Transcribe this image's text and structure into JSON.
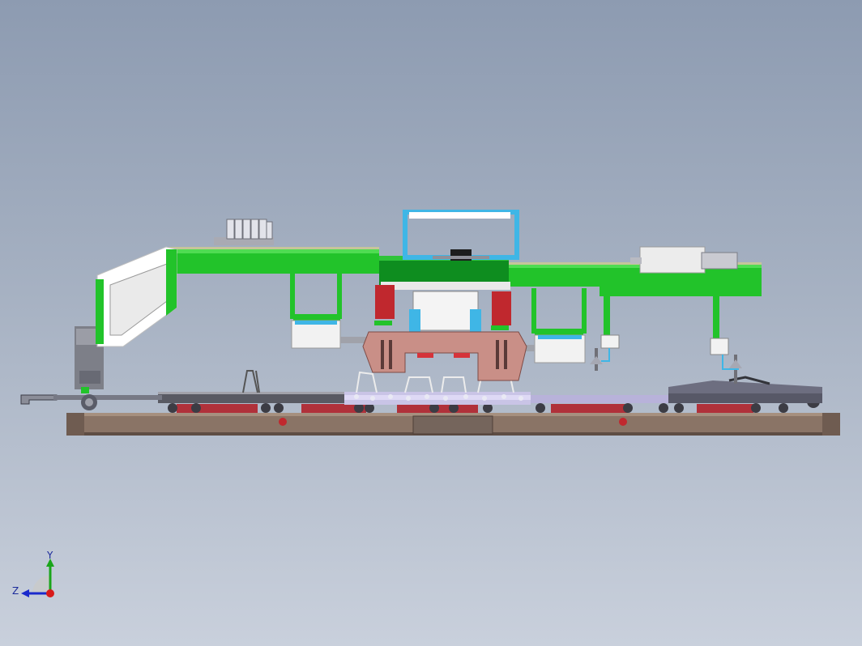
{
  "viewport": {
    "background_top": "#8d9bb1",
    "background_bottom": "#c9d0dc"
  },
  "model_colors": {
    "green": "#22c32a",
    "dark_green": "#0e7a1a",
    "base": "#8a7466",
    "base_dark": "#5e4d44",
    "red_pads": "#b0313a",
    "pink_block": "#c98f87",
    "cyan_frame": "#3fb6e6",
    "lavender_rail": "#b8b2da",
    "gray": "#808083",
    "white": "#ededed"
  },
  "triad": {
    "y_label": "Y",
    "z_label": "Z",
    "y_color": "#1aa51a",
    "z_color": "#1a2acc",
    "x_color": "#d81a1a"
  }
}
